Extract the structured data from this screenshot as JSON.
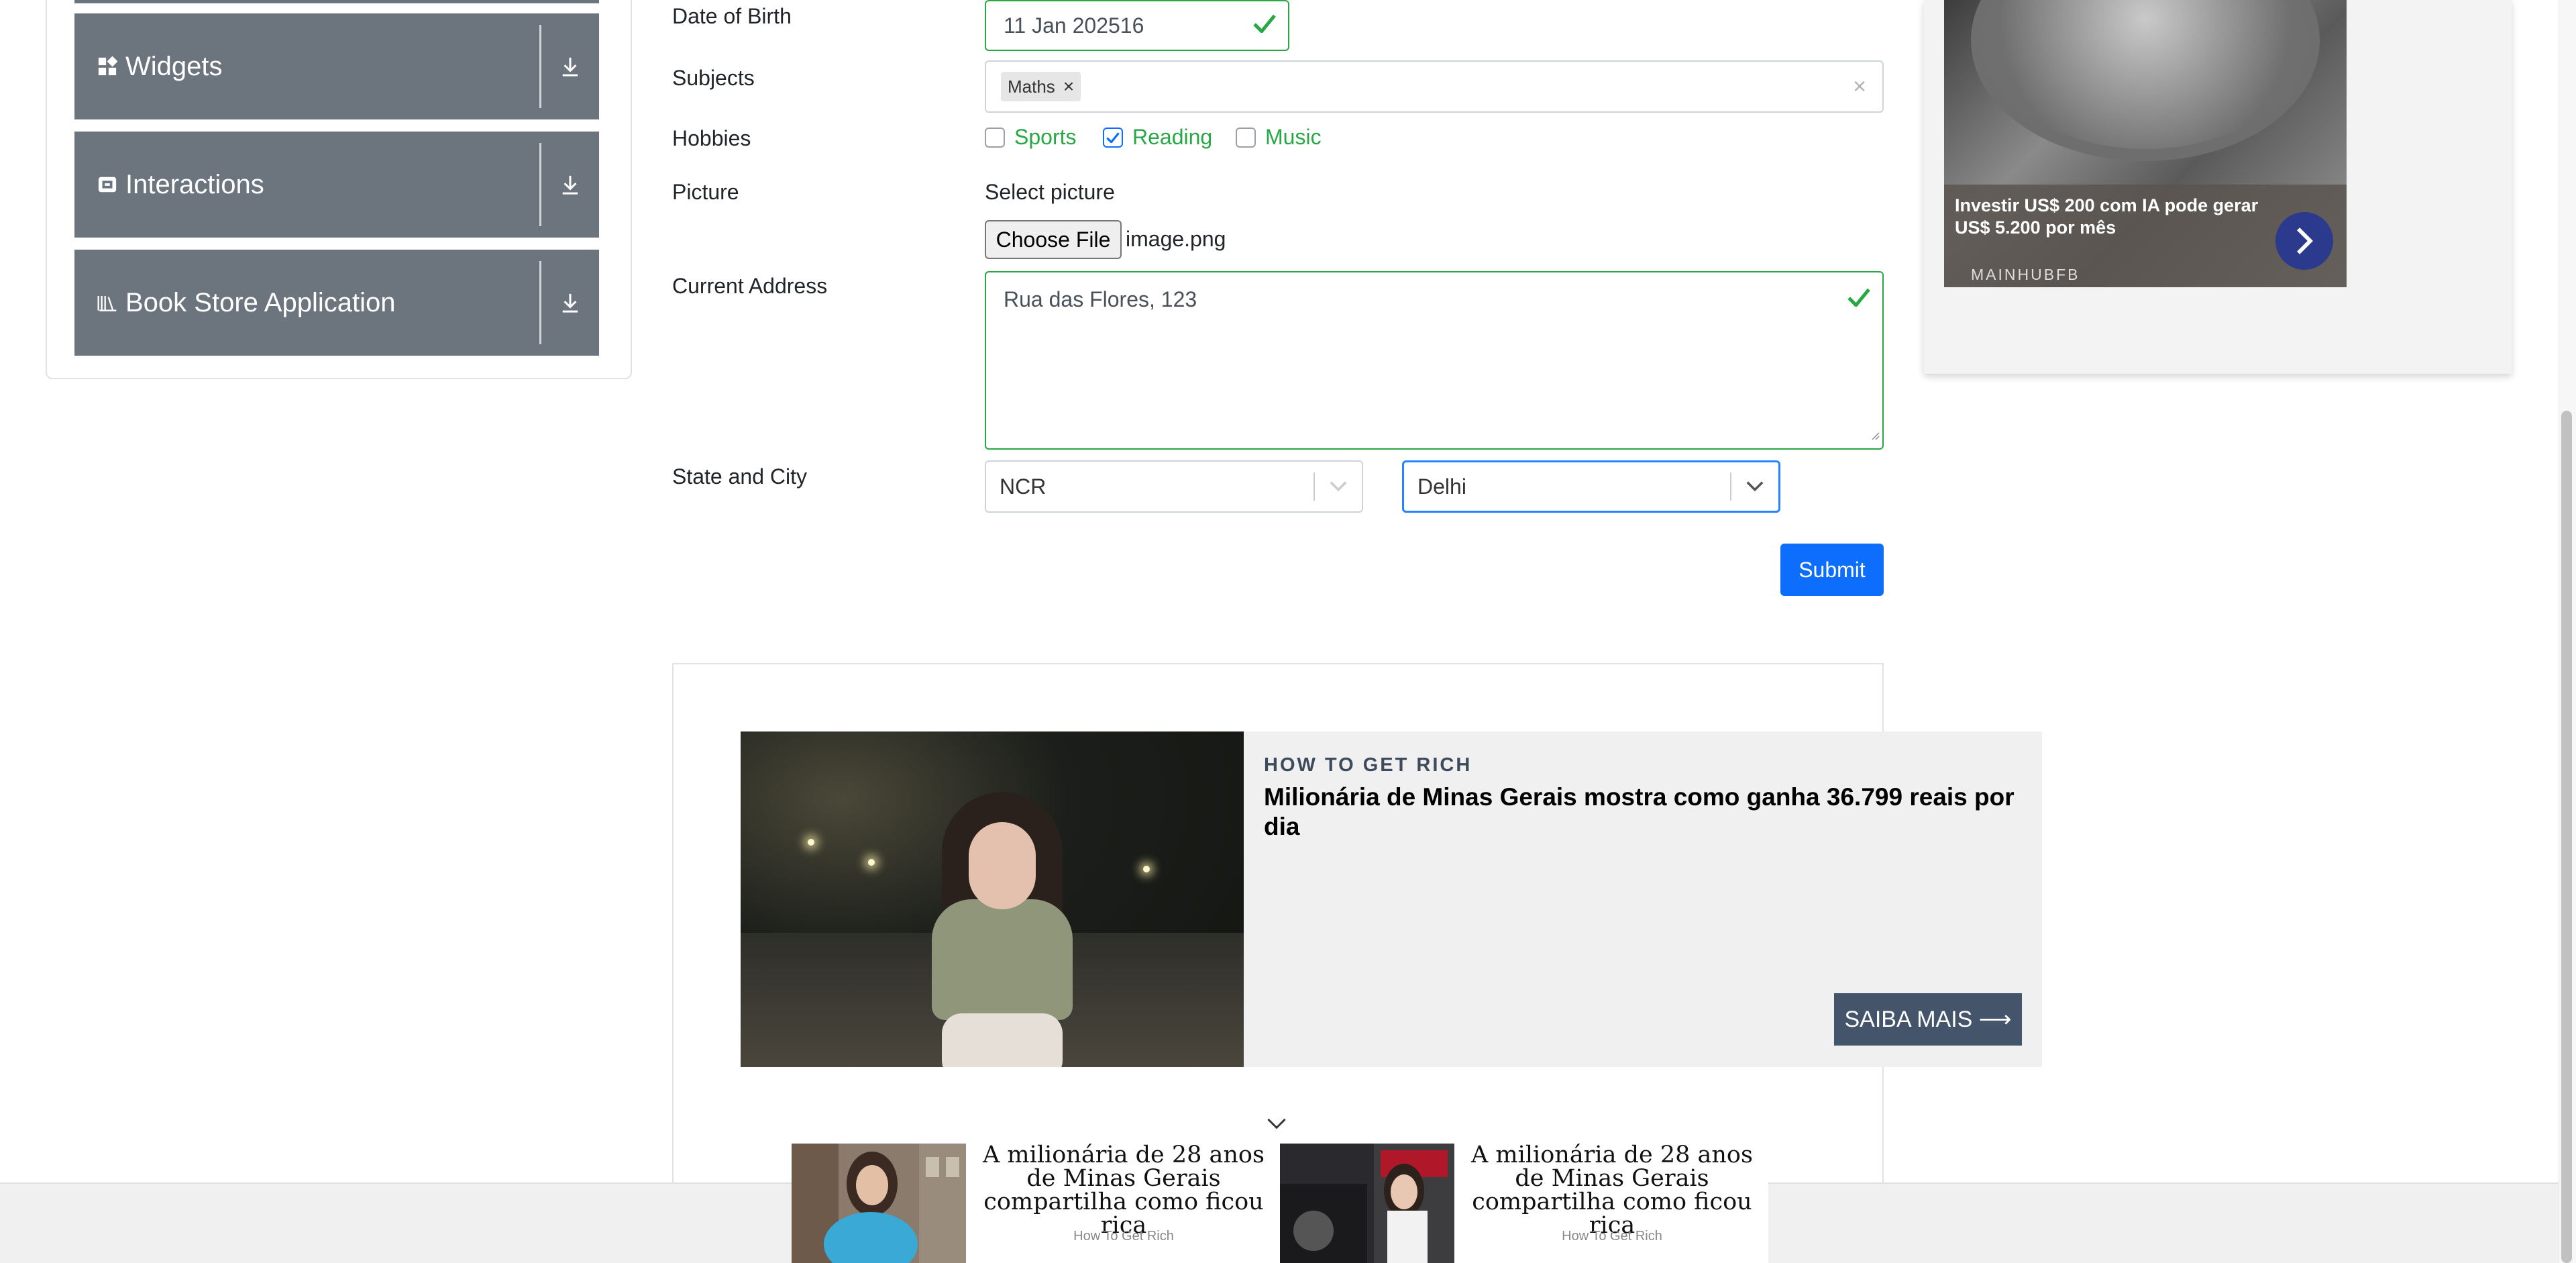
{
  "sidebar": {
    "groups": [
      {
        "label": "Widgets",
        "icon": "widgets-icon"
      },
      {
        "label": "Interactions",
        "icon": "interactions-icon"
      },
      {
        "label": "Book Store Application",
        "icon": "book-store-icon"
      }
    ]
  },
  "form": {
    "dob": {
      "label": "Date of Birth",
      "value": "11 Jan 202516"
    },
    "subjects": {
      "label": "Subjects",
      "chips": [
        "Maths"
      ]
    },
    "hobbies": {
      "label": "Hobbies",
      "options": [
        {
          "label": "Sports",
          "checked": false
        },
        {
          "label": "Reading",
          "checked": true
        },
        {
          "label": "Music",
          "checked": false
        }
      ]
    },
    "picture": {
      "label": "Picture",
      "hint": "Select picture",
      "button": "Choose File",
      "filename": "image.png"
    },
    "address": {
      "label": "Current Address",
      "value": "Rua das Flores, 123"
    },
    "state_city": {
      "label": "State and City",
      "state": "NCR",
      "city": "Delhi"
    },
    "submit": "Submit"
  },
  "right_ad": {
    "text": "Investir US$ 200 com IA pode gerar US$ 5.200 por mês",
    "brand": "MAINHUBFB"
  },
  "main_ad": {
    "kicker": "HOW TO GET RICH",
    "headline": "Milionária de Minas Gerais mostra como ganha 36.799 reais por dia",
    "cta": "SAIBA MAIS ⟶"
  },
  "bottom_ads": [
    {
      "title": "A milionária de 28 anos de Minas Gerais compartilha como ficou rica",
      "source": "How To Get Rich"
    },
    {
      "title": "A milionária de 28 anos de Minas Gerais compartilha como ficou rica",
      "source": "How To Get Rich"
    }
  ],
  "colors": {
    "accent": "#0d6efd",
    "valid": "#28a745",
    "sidebar_header": "#6c757d",
    "ad_cta": "#44546a"
  }
}
